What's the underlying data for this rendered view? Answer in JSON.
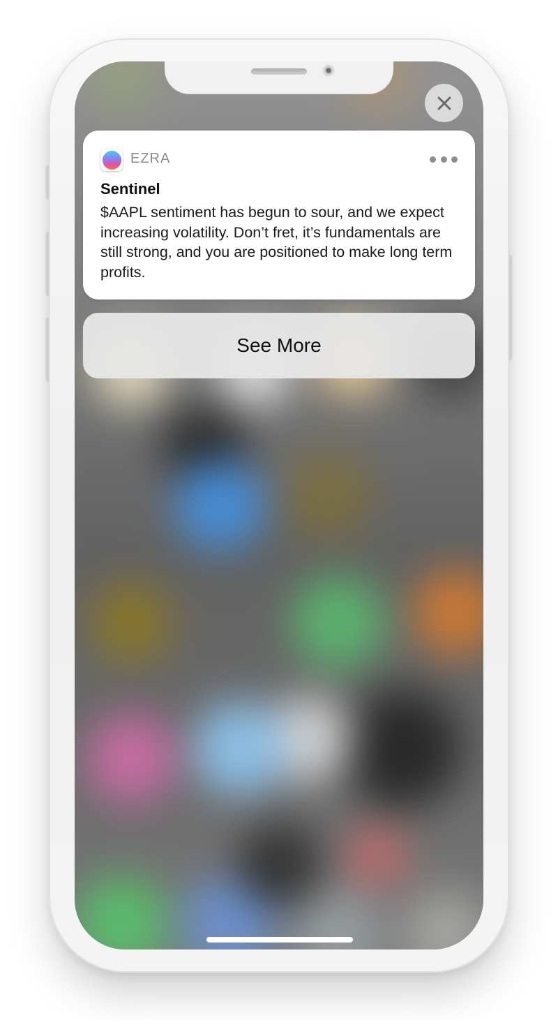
{
  "app": {
    "name": "EZRA",
    "icon": "ezra-orb-icon"
  },
  "notification": {
    "title": "Sentinel",
    "body": "$AAPL sentiment has begun to sour, and we expect increasing volatility. Don’t fret, it’s fundamentals are still strong, and you are positioned to make long term profits."
  },
  "actions": {
    "see_more_label": "See More"
  },
  "controls": {
    "close_icon": "close-icon",
    "more_icon": "more-dots-icon"
  },
  "colors": {
    "card_background": "#ffffff",
    "action_background": "#e8e8e8",
    "app_name_color": "#8c8c8c",
    "text_color": "#111111"
  }
}
